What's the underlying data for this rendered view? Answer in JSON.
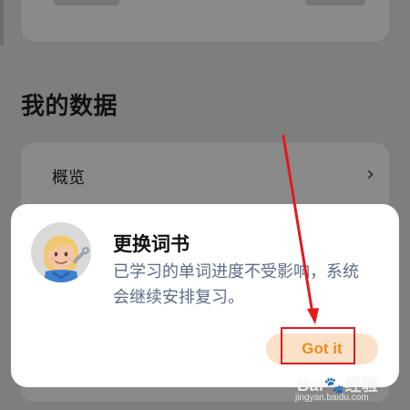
{
  "page": {
    "section_title": "我的数据",
    "overview_label": "概览",
    "overview_chevron": "›"
  },
  "dialog": {
    "title": "更换词书",
    "message": "已学习的单词进度不受影响，系统会继续安排复习。",
    "button_label": "Got it"
  },
  "watermark": {
    "brand": "Bai",
    "site": "jingyan.baidu.com"
  },
  "colors": {
    "accent_orange": "#F08A1D",
    "button_fill": "#FBE1C8",
    "annotation_red": "#E21B1B",
    "message_color": "#5D6B87",
    "dimmed_background": "#7E7E7E"
  },
  "icons": {
    "avatar": "woman-mechanic-emoji",
    "overview_arrow": "chevron-right-icon",
    "annotation_arrow": "red-arrow-icon",
    "watermark_logo": "baidu-paw-icon"
  }
}
